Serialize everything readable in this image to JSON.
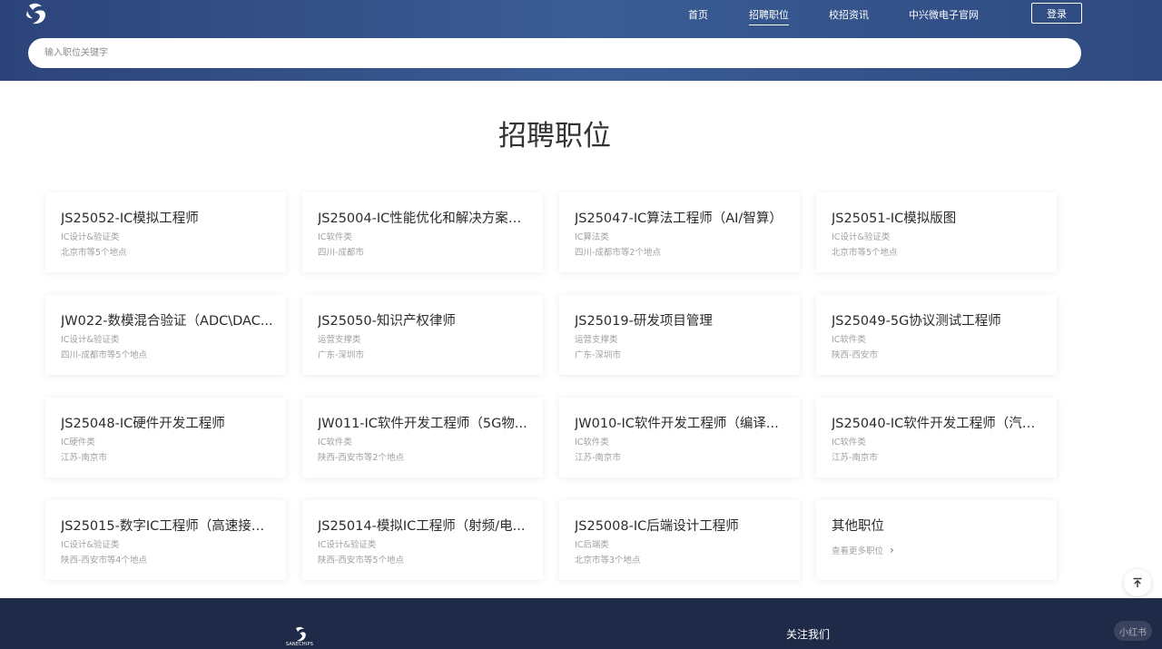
{
  "header": {
    "nav": [
      {
        "label": "首页",
        "active": false
      },
      {
        "label": "招聘职位",
        "active": true
      },
      {
        "label": "校招资讯",
        "active": false
      },
      {
        "label": "中兴微电子官网",
        "active": false
      }
    ],
    "login_label": "登录",
    "search_placeholder": "输入职位关键字"
  },
  "main": {
    "title": "招聘职位",
    "jobs": [
      {
        "title": "JS25052-IC模拟工程师",
        "category": "IC设计&验证类",
        "location": "北京市等5个地点"
      },
      {
        "title": "JS25004-IC性能优化和解决方案（...",
        "category": "IC软件类",
        "location": "四川-成都市"
      },
      {
        "title": "JS25047-IC算法工程师（AI/智算）",
        "category": "IC算法类",
        "location": "四川-成都市等2个地点"
      },
      {
        "title": "JS25051-IC模拟版图",
        "category": "IC设计&验证类",
        "location": "北京市等5个地点"
      },
      {
        "title": "JW022-数模混合验证（ADC\\DAC...",
        "category": "IC设计&验证类",
        "location": "四川-成都市等5个地点"
      },
      {
        "title": "JS25050-知识产权律师",
        "category": "运营支撑类",
        "location": "广东-深圳市"
      },
      {
        "title": "JS25019-研发项目管理",
        "category": "运营支撑类",
        "location": "广东-深圳市"
      },
      {
        "title": "JS25049-5G协议测试工程师",
        "category": "IC软件类",
        "location": "陕西-西安市"
      },
      {
        "title": "JS25048-IC硬件开发工程师",
        "category": "IC硬件类",
        "location": "江苏-南京市"
      },
      {
        "title": "JW011-IC软件开发工程师（5G物...",
        "category": "IC软件类",
        "location": "陕西-西安市等2个地点"
      },
      {
        "title": "JW010-IC软件开发工程师（编译...",
        "category": "IC软件类",
        "location": "江苏-南京市"
      },
      {
        "title": "JS25040-IC软件开发工程师（汽车...",
        "category": "IC软件类",
        "location": "江苏-南京市"
      },
      {
        "title": "JS25015-数字IC工程师（高速接口...",
        "category": "IC设计&验证类",
        "location": "陕西-西安市等4个地点"
      },
      {
        "title": "JS25014-模拟IC工程师（射频/电...",
        "category": "IC设计&验证类",
        "location": "陕西-西安市等5个地点"
      },
      {
        "title": "JS25008-IC后端设计工程师",
        "category": "IC后端类",
        "location": "北京市等3个地点"
      }
    ],
    "other": {
      "title": "其他职位",
      "more_label": "查看更多职位"
    }
  },
  "footer": {
    "logo_text": "SANECHIPS",
    "follow_label": "关注我们",
    "watermark": "小红书"
  },
  "colors": {
    "header_bg": "#3b5c95",
    "footer_bg": "#1f2a48"
  },
  "icons": {
    "logo": "sanechips-logo-icon",
    "back_to_top": "arrow-up-to-line-icon",
    "more": "chevron-right-icon"
  }
}
